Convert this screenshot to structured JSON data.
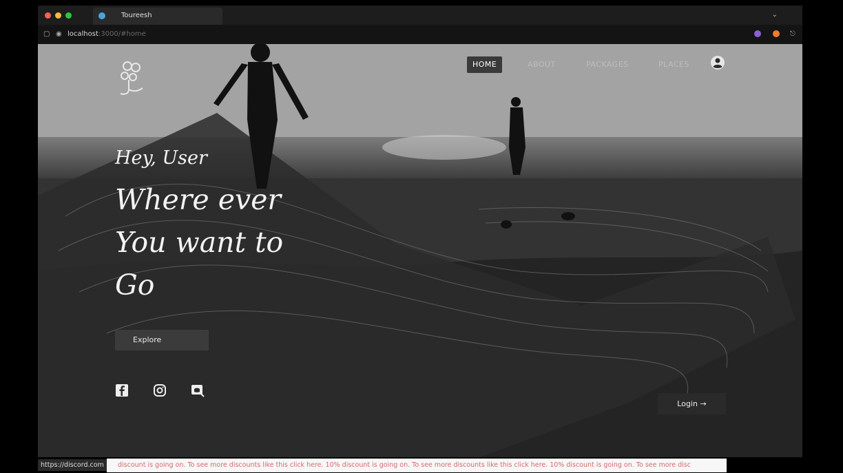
{
  "browser": {
    "tab_title": "Toureesh",
    "url_host": "localhost",
    "url_rest": ":3000/#home"
  },
  "nav": {
    "items": [
      "HOME",
      "ABOUT",
      "PACKAGES",
      "PLACES"
    ],
    "active": "HOME"
  },
  "hero": {
    "greeting": "Hey, User",
    "headline": [
      "Where ever",
      "You want to",
      "Go"
    ],
    "explore_label": "Explore"
  },
  "social": [
    "facebook-icon",
    "instagram-icon",
    "discord-icon"
  ],
  "login_label": "Login →",
  "status": {
    "link": "https://discord.com",
    "marquee": "discount is going on.  To see more discounts like this click here.  10% discount is going on.  To see more discounts like this click here.  10% discount is going on.  To see more disc"
  },
  "colors": {
    "marquee_text": "#d36a6a",
    "nav_active_bg": "#3a3a3a"
  }
}
